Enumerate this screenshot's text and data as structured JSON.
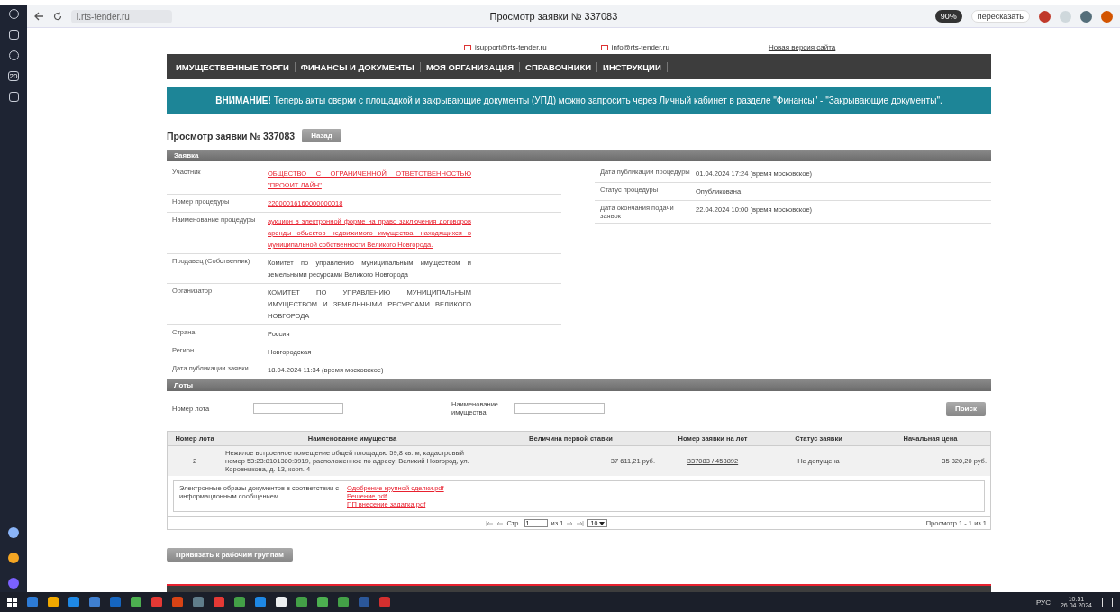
{
  "browser": {
    "url": "l.rts-tender.ru",
    "tab_title": "Просмотр заявки № 337083",
    "zoom": "90%",
    "retell_button": "пересказать",
    "sidebar_badge": "20"
  },
  "header": {
    "emails": [
      "isupport@rts-tender.ru",
      "info@rts-tender.ru"
    ],
    "new_site_link": "Новая версия сайта"
  },
  "nav": [
    "ИМУЩЕСТВЕННЫЕ ТОРГИ",
    "ФИНАНСЫ И ДОКУМЕНТЫ",
    "МОЯ ОРГАНИЗАЦИЯ",
    "СПРАВОЧНИКИ",
    "ИНСТРУКЦИИ"
  ],
  "notice": "**ВНИМАНИЕ!** Теперь акты сверки с площадкой и закрывающие документы (УПД) можно запросить через Личный кабинет в разделе \"Финансы\" - \"Закрывающие документы\".",
  "page_title": "Просмотр заявки № 337083",
  "back_button": "Назад",
  "application": {
    "title": "Заявка",
    "left_rows": [
      {
        "label": "Участник",
        "value": "ОБЩЕСТВО С ОГРАНИЧЕННОЙ ОТВЕТСТВЕННОСТЬЮ \"ПРОФИТ ЛАЙН\"",
        "kind": "link"
      },
      {
        "label": "Номер процедуры",
        "value": "22000016160000000018",
        "kind": "link"
      },
      {
        "label": "Наименование процедуры",
        "value": "аукцион в электронной форме на право заключения договоров аренды объектов недвижимого имущества, находящихся в муниципальной собственности Великого Новгорода.",
        "kind": "link"
      },
      {
        "label": "Продавец (Собственник)",
        "value": "Комитет по управлению муниципальным имуществом и земельными ресурсами Великого Новгорода",
        "kind": "text"
      },
      {
        "label": "Организатор",
        "value": "КОМИТЕТ ПО УПРАВЛЕНИЮ МУНИЦИПАЛЬНЫМ ИМУЩЕСТВОМ И ЗЕМЕЛЬНЫМИ РЕСУРСАМИ ВЕЛИКОГО НОВГОРОДА",
        "kind": "text"
      },
      {
        "label": "Страна",
        "value": "Россия",
        "kind": "text"
      },
      {
        "label": "Регион",
        "value": "Новгородская",
        "kind": "text"
      },
      {
        "label": "Дата публикации заявки",
        "value": "18.04.2024 11:34 (время московское)",
        "kind": "text"
      }
    ],
    "right_rows": [
      {
        "label": "Дата публикации процедуры",
        "value": "01.04.2024 17:24 (время московское)"
      },
      {
        "label": "Статус процедуры",
        "value": "Опубликована"
      },
      {
        "label": "Дата окончания подачи заявок",
        "value": "22.04.2024 10:00 (время московское)"
      }
    ]
  },
  "lots": {
    "title": "Лоты",
    "filter_lot_label": "Номер лота",
    "filter_name_label": "Наименование имущества",
    "search_button": "Поиск",
    "columns": [
      "Номер лота",
      "Наименование имущества",
      "Величина первой ставки",
      "Номер заявки на лот",
      "Статус заявки",
      "Начальная цена"
    ],
    "rows": [
      {
        "lot": "2",
        "name": "Нежилое встроенное помещение общей площадью 59,8 кв. м, кадастровый номер 53:23:8101300:3919, расположенное по адресу: Великий Новгород, ул. Коровникова, д. 13, корп. 4",
        "first_bid": "37 611,21 руб.",
        "application_number": "337083 / 453892",
        "status": "Не допущена",
        "start_price": "35 820,20 руб."
      }
    ],
    "documents_label": "Электронные образы документов в соответствии с информационным сообщением",
    "documents": [
      "Одобрение крупной сделки.pdf",
      "Решение.pdf",
      "ПП внесение задатка.pdf"
    ],
    "pager": {
      "page_label": "Стр.",
      "page": "1",
      "of": "из 1",
      "per_page": "10",
      "summary": "Просмотр 1 - 1 из 1"
    }
  },
  "bind_button": "Привязать к рабочим группам",
  "taskbar": {
    "language": "РУС",
    "time": "10:51",
    "date": "26.04.2024"
  }
}
